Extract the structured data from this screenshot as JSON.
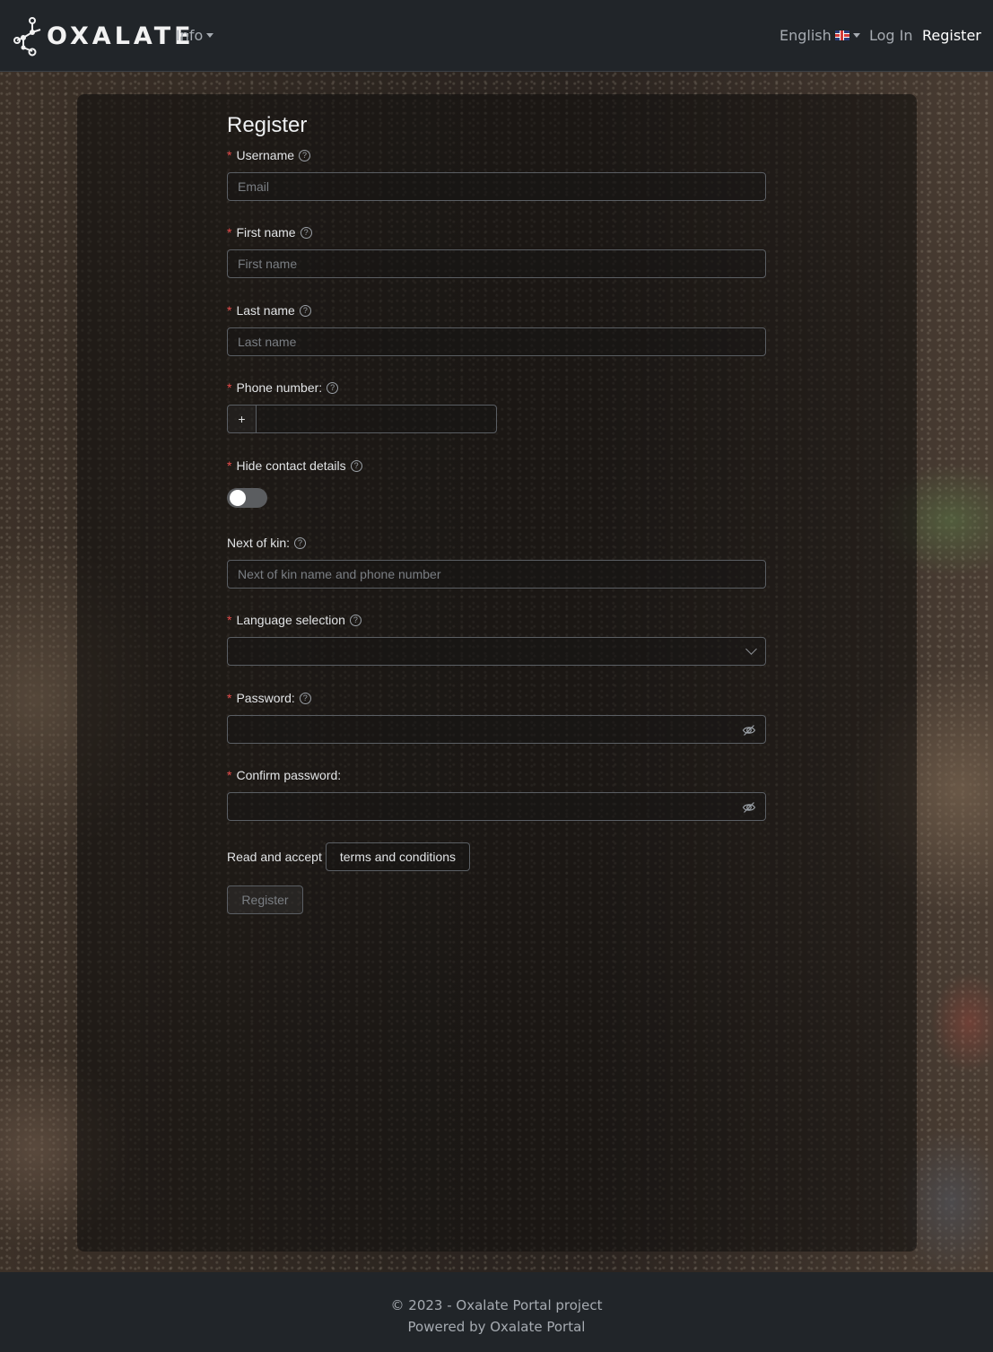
{
  "nav": {
    "brand": "OXALATE",
    "info_label": "Info",
    "language_label": "English",
    "login_label": "Log In",
    "register_label": "Register"
  },
  "form": {
    "title": "Register",
    "required_mark": "*",
    "username": {
      "label": "Username",
      "placeholder": "Email"
    },
    "first_name": {
      "label": "First name",
      "placeholder": "First name"
    },
    "last_name": {
      "label": "Last name",
      "placeholder": "Last name"
    },
    "phone": {
      "label": "Phone number:",
      "prefix": "+"
    },
    "hide_contact": {
      "label": "Hide contact details",
      "enabled": false
    },
    "next_of_kin": {
      "label": "Next of kin:",
      "placeholder": "Next of kin name and phone number"
    },
    "language_selection": {
      "label": "Language selection"
    },
    "password": {
      "label": "Password:"
    },
    "confirm_password": {
      "label": "Confirm password:"
    },
    "terms_text": "Read and accept",
    "terms_button": "terms and conditions",
    "submit_label": "Register"
  },
  "footer": {
    "copyright": "© 2023 - Oxalate Portal project",
    "powered_by": "Powered by Oxalate Portal"
  },
  "colors": {
    "navbar_bg": "#212529",
    "required": "#e84a4a",
    "nav_active": "#ffffff",
    "nav_muted": "#a6abb1"
  }
}
